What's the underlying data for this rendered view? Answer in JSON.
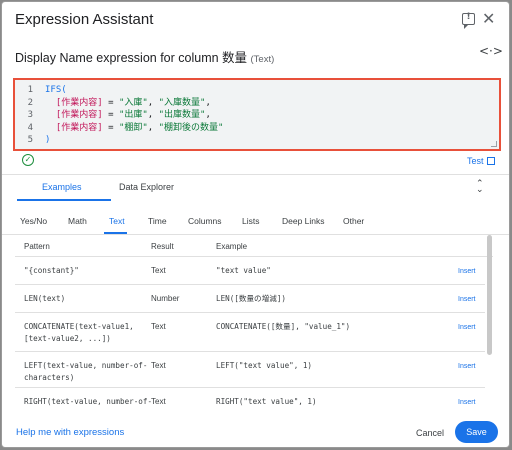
{
  "dialog": {
    "title": "Expression Assistant",
    "subtitle": "Display Name expression for column 数量",
    "subtitle_type": "(Text)"
  },
  "editor": {
    "line_numbers": [
      "1",
      "2",
      "3",
      "4",
      "5"
    ],
    "lines": [
      [
        {
          "t": "IFS(",
          "c": "fn"
        }
      ],
      [
        {
          "t": "  [作業内容]",
          "c": "col"
        },
        {
          "t": " = ",
          "c": "op"
        },
        {
          "t": "\"入庫\"",
          "c": "str"
        },
        {
          "t": ", ",
          "c": "op"
        },
        {
          "t": "\"入庫数量\"",
          "c": "str"
        },
        {
          "t": ",",
          "c": "op"
        }
      ],
      [
        {
          "t": "  [作業内容]",
          "c": "col"
        },
        {
          "t": " = ",
          "c": "op"
        },
        {
          "t": "\"出庫\"",
          "c": "str"
        },
        {
          "t": ", ",
          "c": "op"
        },
        {
          "t": "\"出庫数量\"",
          "c": "str"
        },
        {
          "t": ",",
          "c": "op"
        }
      ],
      [
        {
          "t": "  [作業内容]",
          "c": "col"
        },
        {
          "t": " = ",
          "c": "op"
        },
        {
          "t": "\"棚卸\"",
          "c": "str"
        },
        {
          "t": ", ",
          "c": "op"
        },
        {
          "t": "\"棚卸後の数量\"",
          "c": "str"
        }
      ],
      [
        {
          "t": ")",
          "c": "fn"
        }
      ]
    ]
  },
  "test_label": "Test",
  "main_tabs": [
    "Examples",
    "Data Explorer"
  ],
  "function_tabs": [
    "Yes/No",
    "Math",
    "Text",
    "Time",
    "Columns",
    "Lists",
    "Deep Links",
    "Other"
  ],
  "table": {
    "headers": {
      "pattern": "Pattern",
      "result": "Result",
      "example": "Example"
    },
    "insert_label": "Insert",
    "rows": [
      {
        "pattern": "\"{constant}\"",
        "result": "Text",
        "example": "\"text value\""
      },
      {
        "pattern": "LEN(text)",
        "result": "Number",
        "example": "LEN([数量の増減])"
      },
      {
        "pattern": "CONCATENATE(text-value1,\n[text-value2, ...])",
        "result": "Text",
        "example": "CONCATENATE([数量], \"value_1\")"
      },
      {
        "pattern": "LEFT(text-value, number-of-\ncharacters)",
        "result": "Text",
        "example": "LEFT(\"text value\", 1)"
      },
      {
        "pattern": "RIGHT(text-value, number-of-",
        "result": "Text",
        "example": "RIGHT(\"text value\", 1)"
      }
    ]
  },
  "footer": {
    "help_label": "Help me with expressions",
    "cancel_label": "Cancel",
    "save_label": "Save"
  },
  "colors": {
    "accent": "#1a73e8",
    "editor_border": "#e8503a",
    "valid": "#1e8e3e"
  }
}
